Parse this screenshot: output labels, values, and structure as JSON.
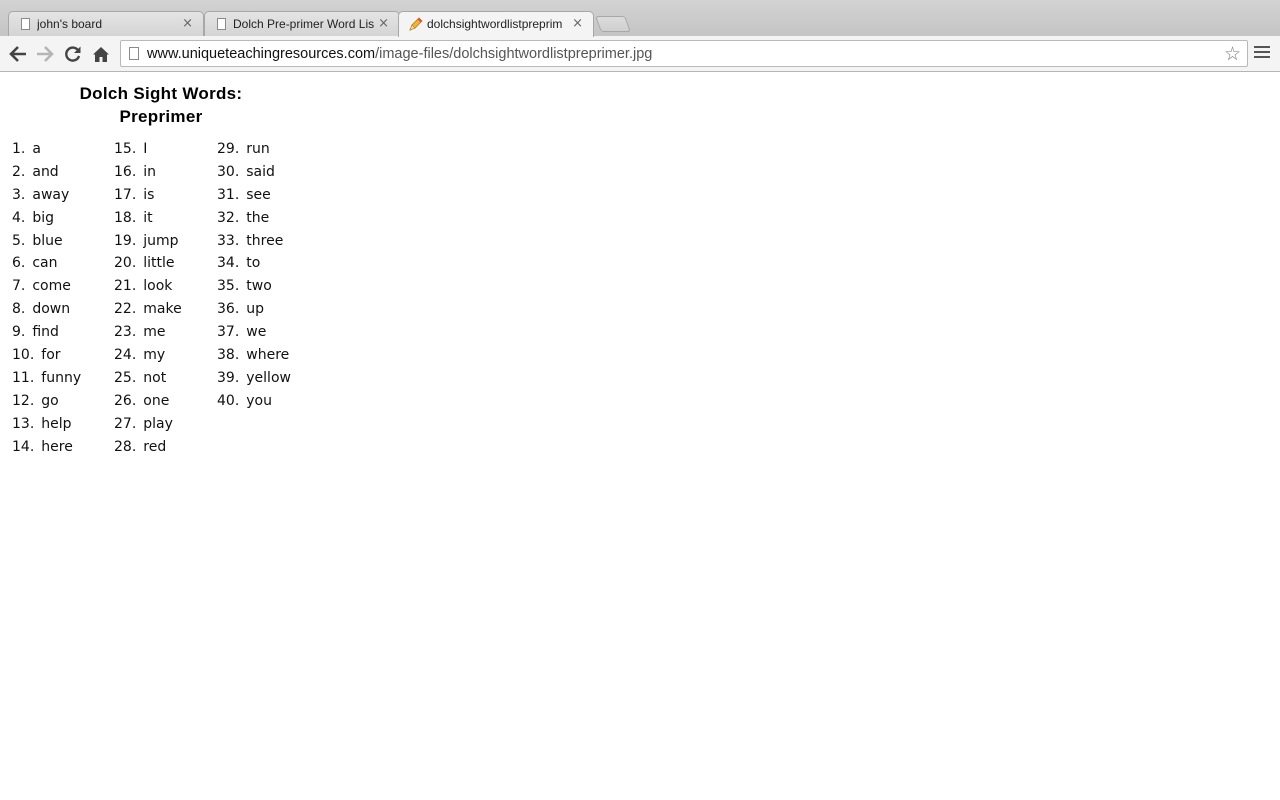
{
  "browser": {
    "tabs": [
      {
        "title": "john's board",
        "active": false,
        "icon": "page-icon"
      },
      {
        "title": "Dolch Pre-primer Word Lis",
        "active": false,
        "icon": "page-icon"
      },
      {
        "title": "dolchsightwordlistpreprim",
        "active": true,
        "icon": "pencil-icon"
      }
    ],
    "tab_close": "×",
    "url_host": "www.uniqueteachingresources.com",
    "url_path": "/image-files/dolchsightwordlistpreprimer.jpg",
    "star": "☆"
  },
  "page": {
    "title_line1": "Dolch Sight Words:",
    "title_line2": "Preprimer",
    "columns": [
      [
        {
          "num": "1.",
          "word": "a"
        },
        {
          "num": "2.",
          "word": "and"
        },
        {
          "num": "3.",
          "word": "away"
        },
        {
          "num": "4.",
          "word": "big"
        },
        {
          "num": "5.",
          "word": "blue"
        },
        {
          "num": "6.",
          "word": "can"
        },
        {
          "num": "7.",
          "word": "come"
        },
        {
          "num": "8.",
          "word": "down"
        },
        {
          "num": "9.",
          "word": "find"
        },
        {
          "num": "10.",
          "word": "for"
        },
        {
          "num": "11.",
          "word": "funny"
        },
        {
          "num": "12.",
          "word": "go"
        },
        {
          "num": "13.",
          "word": "help"
        },
        {
          "num": "14.",
          "word": "here"
        }
      ],
      [
        {
          "num": "15.",
          "word": "I"
        },
        {
          "num": "16.",
          "word": "in"
        },
        {
          "num": "17.",
          "word": "is"
        },
        {
          "num": "18.",
          "word": "it"
        },
        {
          "num": "19.",
          "word": "jump"
        },
        {
          "num": "20.",
          "word": "little"
        },
        {
          "num": "21.",
          "word": "look"
        },
        {
          "num": "22.",
          "word": "make"
        },
        {
          "num": "23.",
          "word": "me"
        },
        {
          "num": "24.",
          "word": "my"
        },
        {
          "num": "25.",
          "word": "not"
        },
        {
          "num": "26.",
          "word": "one"
        },
        {
          "num": "27.",
          "word": "play"
        },
        {
          "num": "28.",
          "word": "red"
        }
      ],
      [
        {
          "num": "29.",
          "word": "run"
        },
        {
          "num": "30.",
          "word": "said"
        },
        {
          "num": "31.",
          "word": "see"
        },
        {
          "num": "32.",
          "word": "the"
        },
        {
          "num": "33.",
          "word": "three"
        },
        {
          "num": "34.",
          "word": "to"
        },
        {
          "num": "35.",
          "word": "two"
        },
        {
          "num": "36.",
          "word": "up"
        },
        {
          "num": "37.",
          "word": "we"
        },
        {
          "num": "38.",
          "word": "where"
        },
        {
          "num": "39.",
          "word": "yellow"
        },
        {
          "num": "40.",
          "word": "you"
        }
      ]
    ]
  }
}
